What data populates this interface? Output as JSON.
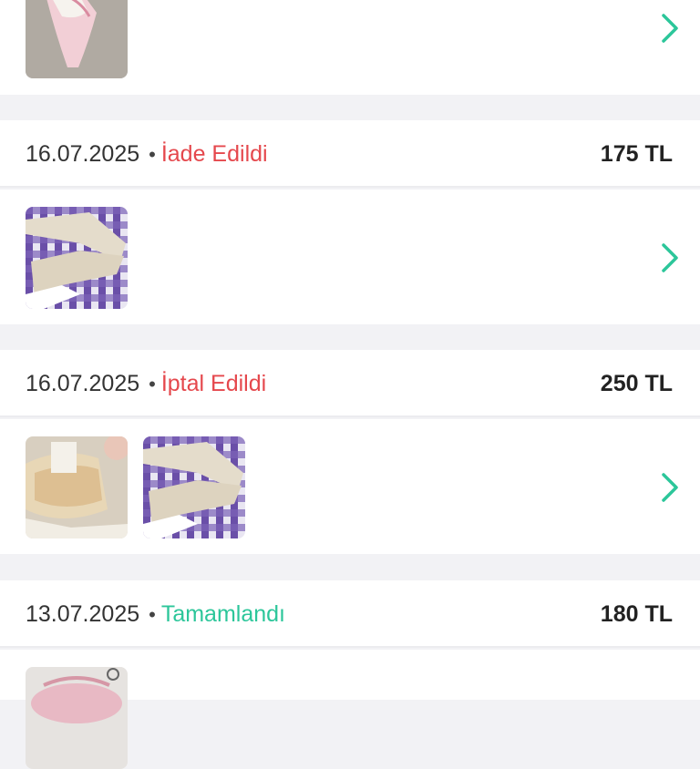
{
  "orders": [
    {
      "date": "",
      "status": "",
      "price": ""
    },
    {
      "date": "16.07.2025",
      "status": "İade Edildi",
      "status_color": "#e5484d",
      "price": "175 TL",
      "thumbnails": [
        "cream-cargo-pants-photo"
      ]
    },
    {
      "date": "16.07.2025",
      "status": "İptal Edildi",
      "status_color": "#e5484d",
      "price": "250 TL",
      "thumbnails": [
        "crochet-bag-photo",
        "cream-cargo-pants-photo"
      ]
    },
    {
      "date": "13.07.2025",
      "status": "Tamamlandı",
      "status_color": "#2cc69a",
      "price": "180 TL",
      "thumbnails": [
        "pink-flipflops-photo"
      ]
    }
  ],
  "separator": "•",
  "icons": {
    "chevron": "chevron-right-icon"
  },
  "colors": {
    "accent": "#2cc69a",
    "status_red": "#e5484d",
    "background": "#f2f2f5"
  }
}
